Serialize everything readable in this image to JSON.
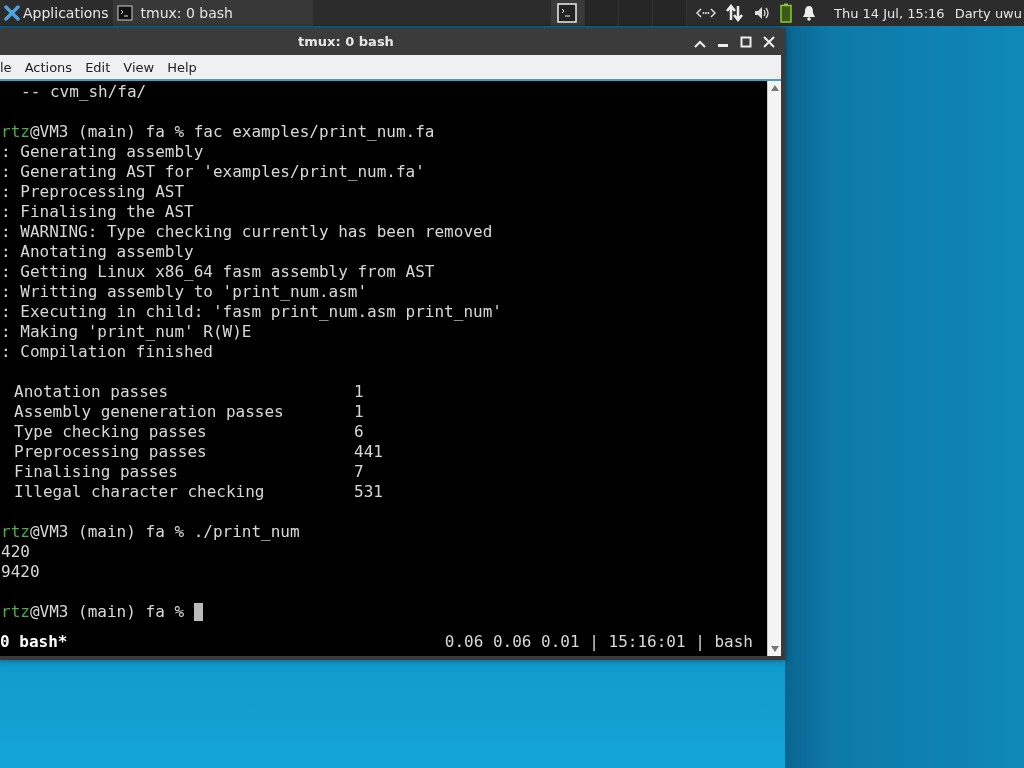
{
  "panel": {
    "apps_label": "Applications",
    "tasks": [
      {
        "label": "tmux: 0 bash",
        "selected": true
      }
    ],
    "workspaces": [
      {
        "selected": true,
        "has_window": true
      },
      {
        "selected": false,
        "has_window": false
      },
      {
        "selected": false,
        "has_window": false
      },
      {
        "selected": false,
        "has_window": false
      }
    ],
    "clock": "Thu 14 Jul, 15:16",
    "user": "Darty uwu"
  },
  "window": {
    "title": "tmux: 0 bash",
    "menu": [
      "le",
      "Actions",
      "Edit",
      "View",
      "Help"
    ]
  },
  "terminal": {
    "lines": [
      {
        "kind": "text",
        "text": "-- cvm_sh/fa/"
      },
      {
        "kind": "blank"
      },
      {
        "kind": "prompt",
        "user": "rtz",
        "text": "@VM3 (main) fa % fac examples/print_num.fa"
      },
      {
        "kind": "text",
        "text": ": Generating assembly"
      },
      {
        "kind": "text",
        "text": ": Generating AST for 'examples/print_num.fa'"
      },
      {
        "kind": "text",
        "text": ": Preprocessing AST"
      },
      {
        "kind": "text",
        "text": ": Finalising the AST"
      },
      {
        "kind": "text",
        "text": ": WARNING: Type checking currently has been removed"
      },
      {
        "kind": "text",
        "text": ": Anotating assembly"
      },
      {
        "kind": "text",
        "text": ": Getting Linux x86_64 fasm assembly from AST"
      },
      {
        "kind": "text",
        "text": ": Writting assembly to 'print_num.asm'"
      },
      {
        "kind": "text",
        "text": ": Executing in child: 'fasm print_num.asm print_num'"
      },
      {
        "kind": "text",
        "text": ": Making 'print_num' R(W)E"
      },
      {
        "kind": "text",
        "text": ": Compilation finished"
      },
      {
        "kind": "blank"
      },
      {
        "kind": "stat",
        "label": "Anotation passes",
        "value": "1"
      },
      {
        "kind": "stat",
        "label": "Assembly geneneration passes",
        "value": "1"
      },
      {
        "kind": "stat",
        "label": "Type checking passes",
        "value": "6"
      },
      {
        "kind": "stat",
        "label": "Preprocessing passes",
        "value": "441"
      },
      {
        "kind": "stat",
        "label": "Finalising passes",
        "value": "7"
      },
      {
        "kind": "stat",
        "label": "Illegal character checking",
        "value": "531"
      },
      {
        "kind": "blank"
      },
      {
        "kind": "prompt",
        "user": "rtz",
        "text": "@VM3 (main) fa % ./print_num"
      },
      {
        "kind": "text",
        "text": "420"
      },
      {
        "kind": "text",
        "text": "9420"
      },
      {
        "kind": "blank"
      },
      {
        "kind": "prompt",
        "user": "rtz",
        "text": "@VM3 (main) fa %",
        "cursor": true
      }
    ],
    "status_left": "0 bash*",
    "status_right": "0.06 0.06 0.01 | 15:16:01 | bash"
  }
}
